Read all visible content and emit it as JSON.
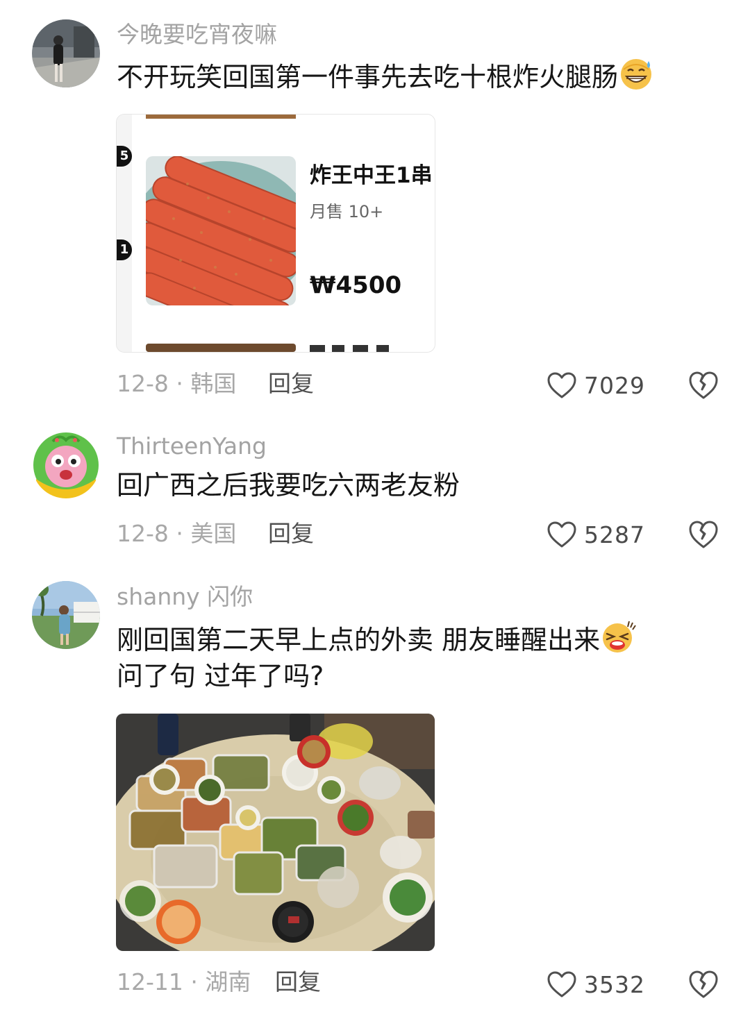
{
  "comments": [
    {
      "username": "今晚要吃宵夜嘛",
      "text": "不开玩笑回国第一件事先去吃十根炸火腿肠",
      "emoji": "grinning-sweat-emoji",
      "meta": "12-8 · 韩国",
      "reply_label": "回复",
      "likes": "7029",
      "product_card": {
        "badge_top": "5",
        "badge_bottom": "1",
        "name": "炸王中王1串",
        "sales": "月售 10+",
        "price": "₩4500"
      }
    },
    {
      "username": "ThirteenYang",
      "text": "回广西之后我要吃六两老友粉",
      "meta": "12-8 · 美国",
      "reply_label": "回复",
      "likes": "5287"
    },
    {
      "username": "shanny 闪你",
      "text_line1": "刚回国第二天早上点的外卖 朋友睡醒出来",
      "text_line2": "问了句 过年了吗?",
      "emoji": "laughing-crying-emoji",
      "meta": "12-11 · 湖南",
      "reply_label": "回复",
      "likes": "3532"
    }
  ],
  "colors": {
    "username": "#a3a3a3",
    "text": "#161616",
    "meta": "#a8a8a8",
    "icon": "#505050"
  }
}
